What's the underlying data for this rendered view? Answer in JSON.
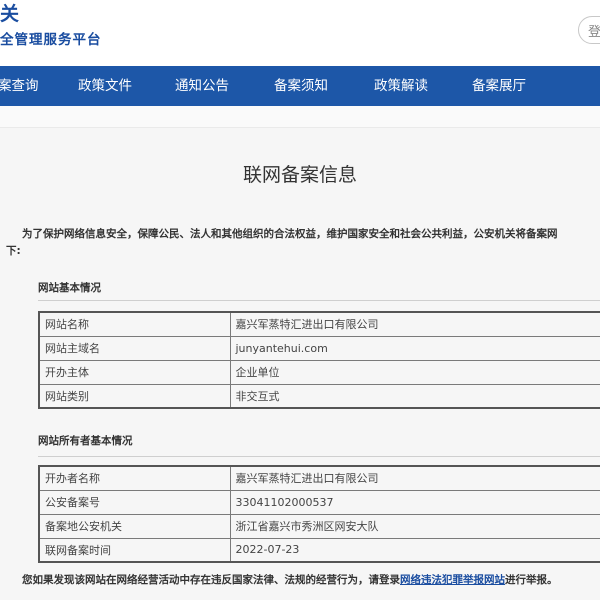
{
  "header": {
    "logo_line1": "关",
    "logo_line2": "全管理服务平台",
    "button_label": "登"
  },
  "nav": {
    "items": [
      {
        "label": "案查询"
      },
      {
        "label": "政策文件"
      },
      {
        "label": "通知公告"
      },
      {
        "label": "备案须知"
      },
      {
        "label": "政策解读"
      },
      {
        "label": "备案展厅"
      }
    ]
  },
  "main": {
    "title": "联网备案信息",
    "intro_line1": "为了保护网络信息安全，保障公民、法人和其他组织的合法权益，维护国家安全和社会公共利益，公安机关将备案网",
    "intro_line2": "下:",
    "site_section": {
      "title": "网站基本情况",
      "rows": [
        {
          "key": "网站名称",
          "value": "嘉兴军蒸特汇进出口有限公司"
        },
        {
          "key": "网站主域名",
          "value": "junyantehui.com"
        },
        {
          "key": "开办主体",
          "value": "企业单位"
        },
        {
          "key": "网站类别",
          "value": "非交互式"
        }
      ]
    },
    "owner_section": {
      "title": "网站所有者基本情况",
      "rows": [
        {
          "key": "开办者名称",
          "value": "嘉兴军蒸特汇进出口有限公司"
        },
        {
          "key": "公安备案号",
          "value": "33041102000537"
        },
        {
          "key": "备案地公安机关",
          "value": "浙江省嘉兴市秀洲区网安大队"
        },
        {
          "key": "联网备案时间",
          "value": "2022-07-23"
        }
      ]
    },
    "footer": {
      "prefix": "您如果发现该网站在网络经营活动中存在违反国家法律、法规的经营行为，请登录",
      "link": "网络违法犯罪举报网站",
      "suffix": "进行举报。"
    }
  }
}
